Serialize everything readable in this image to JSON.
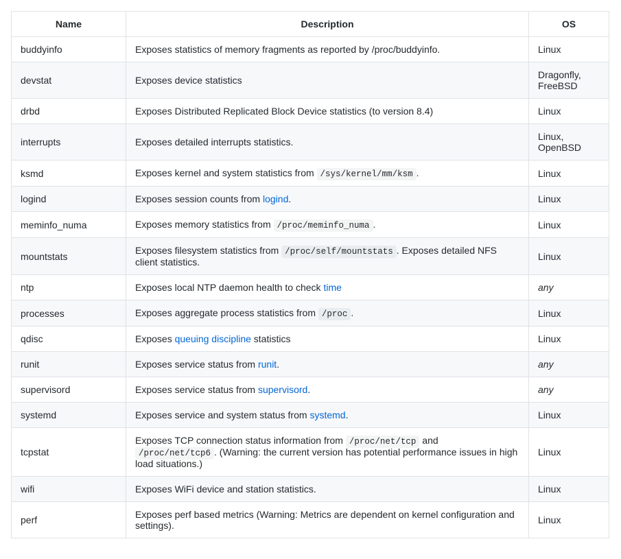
{
  "table": {
    "headers": {
      "name": "Name",
      "description": "Description",
      "os": "OS"
    },
    "rows": [
      {
        "name": "buddyinfo",
        "desc": [
          {
            "t": "text",
            "v": "Exposes statistics of memory fragments as reported by /proc/buddyinfo."
          }
        ],
        "os": "Linux"
      },
      {
        "name": "devstat",
        "desc": [
          {
            "t": "text",
            "v": "Exposes device statistics"
          }
        ],
        "os": "Dragonfly, FreeBSD"
      },
      {
        "name": "drbd",
        "desc": [
          {
            "t": "text",
            "v": "Exposes Distributed Replicated Block Device statistics (to version 8.4)"
          }
        ],
        "os": "Linux"
      },
      {
        "name": "interrupts",
        "desc": [
          {
            "t": "text",
            "v": "Exposes detailed interrupts statistics."
          }
        ],
        "os": "Linux, OpenBSD"
      },
      {
        "name": "ksmd",
        "desc": [
          {
            "t": "text",
            "v": "Exposes kernel and system statistics from "
          },
          {
            "t": "code",
            "v": "/sys/kernel/mm/ksm"
          },
          {
            "t": "text",
            "v": "."
          }
        ],
        "os": "Linux"
      },
      {
        "name": "logind",
        "desc": [
          {
            "t": "text",
            "v": "Exposes session counts from "
          },
          {
            "t": "link",
            "v": "logind"
          },
          {
            "t": "text",
            "v": "."
          }
        ],
        "os": "Linux"
      },
      {
        "name": "meminfo_numa",
        "desc": [
          {
            "t": "text",
            "v": "Exposes memory statistics from "
          },
          {
            "t": "code",
            "v": "/proc/meminfo_numa"
          },
          {
            "t": "text",
            "v": "."
          }
        ],
        "os": "Linux"
      },
      {
        "name": "mountstats",
        "desc": [
          {
            "t": "text",
            "v": "Exposes filesystem statistics from "
          },
          {
            "t": "code",
            "v": "/proc/self/mountstats"
          },
          {
            "t": "text",
            "v": ". Exposes detailed NFS client statistics."
          }
        ],
        "os": "Linux"
      },
      {
        "name": "ntp",
        "desc": [
          {
            "t": "text",
            "v": "Exposes local NTP daemon health to check "
          },
          {
            "t": "link",
            "v": "time"
          }
        ],
        "os_italic": "any"
      },
      {
        "name": "processes",
        "desc": [
          {
            "t": "text",
            "v": "Exposes aggregate process statistics from "
          },
          {
            "t": "code",
            "v": "/proc"
          },
          {
            "t": "text",
            "v": "."
          }
        ],
        "os": "Linux"
      },
      {
        "name": "qdisc",
        "desc": [
          {
            "t": "text",
            "v": "Exposes "
          },
          {
            "t": "link",
            "v": "queuing discipline"
          },
          {
            "t": "text",
            "v": " statistics"
          }
        ],
        "os": "Linux"
      },
      {
        "name": "runit",
        "desc": [
          {
            "t": "text",
            "v": "Exposes service status from "
          },
          {
            "t": "link",
            "v": "runit"
          },
          {
            "t": "text",
            "v": "."
          }
        ],
        "os_italic": "any"
      },
      {
        "name": "supervisord",
        "desc": [
          {
            "t": "text",
            "v": "Exposes service status from "
          },
          {
            "t": "link",
            "v": "supervisord"
          },
          {
            "t": "text",
            "v": "."
          }
        ],
        "os_italic": "any"
      },
      {
        "name": "systemd",
        "desc": [
          {
            "t": "text",
            "v": "Exposes service and system status from "
          },
          {
            "t": "link",
            "v": "systemd"
          },
          {
            "t": "text",
            "v": "."
          }
        ],
        "os": "Linux"
      },
      {
        "name": "tcpstat",
        "desc": [
          {
            "t": "text",
            "v": "Exposes TCP connection status information from "
          },
          {
            "t": "code",
            "v": "/proc/net/tcp"
          },
          {
            "t": "text",
            "v": " and "
          },
          {
            "t": "code",
            "v": "/proc/net/tcp6"
          },
          {
            "t": "text",
            "v": ". (Warning: the current version has potential performance issues in high load situations.)"
          }
        ],
        "os": "Linux"
      },
      {
        "name": "wifi",
        "desc": [
          {
            "t": "text",
            "v": "Exposes WiFi device and station statistics."
          }
        ],
        "os": "Linux"
      },
      {
        "name": "perf",
        "desc": [
          {
            "t": "text",
            "v": "Exposes perf based metrics (Warning: Metrics are dependent on kernel configuration and settings)."
          }
        ],
        "os": "Linux"
      }
    ]
  }
}
